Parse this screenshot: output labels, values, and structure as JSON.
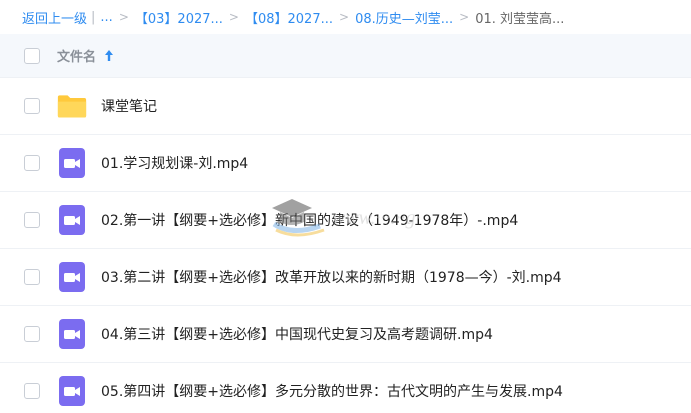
{
  "breadcrumb": {
    "back_label": "返回上一级",
    "ellipsis": "...",
    "items": [
      "【03】2027...",
      "【08】2027...",
      "08.历史—刘莹...",
      "01. 刘莹莹高..."
    ]
  },
  "header": {
    "column_label": "文件名",
    "sort_direction": "ascending"
  },
  "files": [
    {
      "name": "课堂笔记",
      "type": "folder"
    },
    {
      "name": "01.学习规划课-刘.mp4",
      "type": "video"
    },
    {
      "name": "02.第一讲【纲要+选必修】新中国的建设（1949-1978年）-.mp4",
      "type": "video"
    },
    {
      "name": "03.第二讲【纲要+选必修】改革开放以来的新时期（1978—今）-刘.mp4",
      "type": "video"
    },
    {
      "name": "04.第三讲【纲要+选必修】中国现代史复习及高考题调研.mp4",
      "type": "video"
    },
    {
      "name": "05.第四讲【纲要+选必修】多元分散的世界：古代文明的产生与发展.mp4",
      "type": "video"
    }
  ],
  "colors": {
    "accent": "#2f8cf0",
    "folder": "#ffd24d",
    "video": "#7b6cf0",
    "header_bg": "#f5f8fc"
  }
}
